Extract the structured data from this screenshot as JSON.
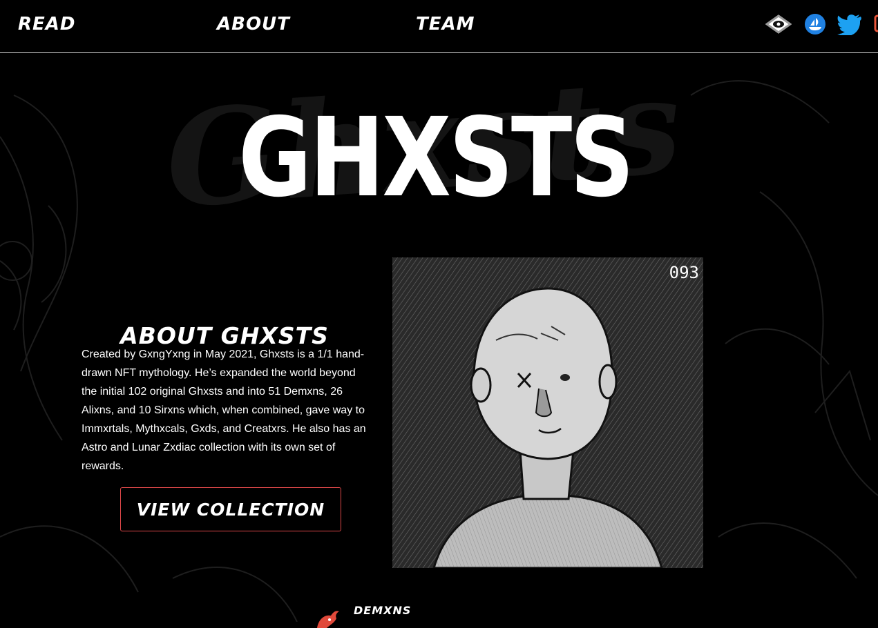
{
  "nav": {
    "links": [
      {
        "label": "READ"
      },
      {
        "label": "ABOUT"
      },
      {
        "label": "TEAM"
      }
    ],
    "social": [
      {
        "name": "eye-icon",
        "color": "#cfcfcf"
      },
      {
        "name": "opensea-icon",
        "color": "#2081e2"
      },
      {
        "name": "twitter-icon",
        "color": "#1da1f2"
      },
      {
        "name": "partial-orange-icon",
        "color": "#e8553a"
      }
    ]
  },
  "hero": {
    "logo_text": "GHXSTS",
    "background_word": "Ghxsts"
  },
  "about": {
    "title": "ABOUT GHXSTS",
    "body": "Created by GxngYxng in May 2021, Ghxsts is a 1/1 hand-drawn NFT mythology. He’s expanded the world beyond the initial 102 original Ghxsts and into 51 Demxns, 26 Alixns, and 10 Sirxns which, when combined, gave way to Immxrtals, Mythxcals, Gxds, and Creatxrs. He also has an Astro and Lunar Zxdiac collection with its own set of rewards.",
    "cta_label": "VIEW COLLECTION",
    "artwork_number": "093",
    "accent_color": "#e0494a"
  },
  "next_section": {
    "label": "DEMXNS",
    "icon": "demxns-icon",
    "icon_color": "#e0493a"
  }
}
